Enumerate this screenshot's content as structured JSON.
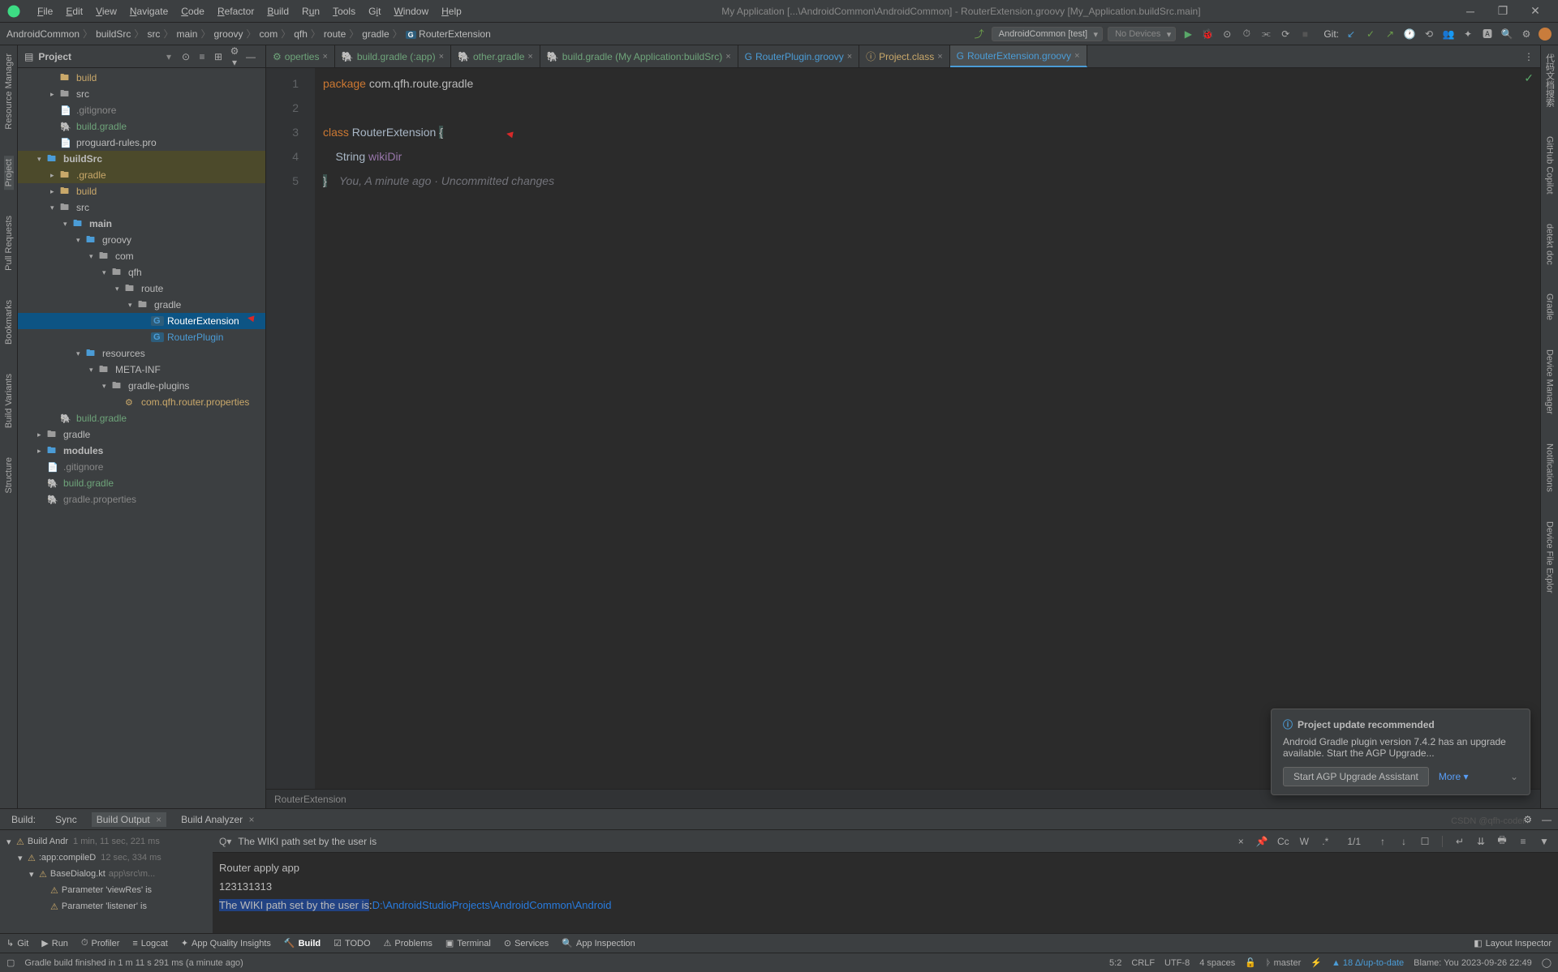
{
  "window": {
    "title": "My Application [...\\AndroidCommon\\AndroidCommon] - RouterExtension.groovy [My_Application.buildSrc.main]"
  },
  "menu": [
    "File",
    "Edit",
    "View",
    "Navigate",
    "Code",
    "Refactor",
    "Build",
    "Run",
    "Tools",
    "Git",
    "Window",
    "Help"
  ],
  "breadcrumb": [
    "AndroidCommon",
    "buildSrc",
    "src",
    "main",
    "groovy",
    "com",
    "qfh",
    "route",
    "gradle",
    "RouterExtension"
  ],
  "toolbar": {
    "runConfig": "AndroidCommon [test]",
    "device": "No Devices",
    "gitLabel": "Git:"
  },
  "projectPanel": {
    "title": "Project"
  },
  "tree": [
    {
      "depth": 2,
      "icon": "folder-open",
      "label": "build",
      "color": "#c9a86a"
    },
    {
      "depth": 2,
      "arrow": "▸",
      "icon": "folder",
      "label": "src"
    },
    {
      "depth": 2,
      "icon": "file",
      "label": ".gitignore",
      "fileColor": "#888"
    },
    {
      "depth": 2,
      "icon": "gradle",
      "label": "build.gradle",
      "color": "#6ea47a"
    },
    {
      "depth": 2,
      "icon": "file",
      "label": "proguard-rules.pro"
    },
    {
      "depth": 1,
      "arrow": "▾",
      "icon": "folder-b",
      "label": "buildSrc",
      "bold": true,
      "hl": true
    },
    {
      "depth": 2,
      "arrow": "▸",
      "icon": "folder-open",
      "label": ".gradle",
      "color": "#c9a86a",
      "hl": true
    },
    {
      "depth": 2,
      "arrow": "▸",
      "icon": "folder-open",
      "label": "build",
      "color": "#c9a86a"
    },
    {
      "depth": 2,
      "arrow": "▾",
      "icon": "folder",
      "label": "src"
    },
    {
      "depth": 3,
      "arrow": "▾",
      "icon": "folder-b",
      "label": "main",
      "bold": true
    },
    {
      "depth": 4,
      "arrow": "▾",
      "icon": "folder-b",
      "label": "groovy"
    },
    {
      "depth": 5,
      "arrow": "▾",
      "icon": "folder",
      "label": "com"
    },
    {
      "depth": 6,
      "arrow": "▾",
      "icon": "folder",
      "label": "qfh"
    },
    {
      "depth": 7,
      "arrow": "▾",
      "icon": "folder",
      "label": "route"
    },
    {
      "depth": 8,
      "arrow": "▾",
      "icon": "folder",
      "label": "gradle"
    },
    {
      "depth": 9,
      "icon": "groovy",
      "label": "RouterExtension",
      "sel": true
    },
    {
      "depth": 9,
      "icon": "groovy",
      "label": "RouterPlugin",
      "color": "#4b9cd6"
    },
    {
      "depth": 4,
      "arrow": "▾",
      "icon": "folder-b",
      "label": "resources"
    },
    {
      "depth": 5,
      "arrow": "▾",
      "icon": "folder",
      "label": "META-INF"
    },
    {
      "depth": 6,
      "arrow": "▾",
      "icon": "folder",
      "label": "gradle-plugins"
    },
    {
      "depth": 7,
      "icon": "props",
      "label": "com.qfh.router.properties",
      "color": "#c9a86a"
    },
    {
      "depth": 2,
      "icon": "gradle",
      "label": "build.gradle",
      "color": "#6ea47a"
    },
    {
      "depth": 1,
      "arrow": "▸",
      "icon": "folder",
      "label": "gradle"
    },
    {
      "depth": 1,
      "arrow": "▸",
      "icon": "folder-b",
      "label": "modules",
      "bold": true
    },
    {
      "depth": 1,
      "icon": "file",
      "label": ".gitignore",
      "fileColor": "#888"
    },
    {
      "depth": 1,
      "icon": "gradle",
      "label": "build.gradle",
      "color": "#6ea47a"
    },
    {
      "depth": 1,
      "icon": "gradle",
      "label": "gradle.properties",
      "color": "#888"
    }
  ],
  "tabs": [
    {
      "icon": "⚙",
      "label": "operties",
      "color": "#6ea47a"
    },
    {
      "icon": "🐘",
      "label": "build.gradle (:app)",
      "color": "#6ea47a"
    },
    {
      "icon": "🐘",
      "label": "other.gradle",
      "color": "#6ea47a"
    },
    {
      "icon": "🐘",
      "label": "build.gradle (My Application:buildSrc)",
      "color": "#6ea47a"
    },
    {
      "icon": "G",
      "label": "RouterPlugin.groovy",
      "color": "#4b9cd6"
    },
    {
      "icon": "ⓘ",
      "label": "Project.class",
      "color": "#c9a86a"
    },
    {
      "icon": "G",
      "label": "RouterExtension.groovy",
      "active": true,
      "color": "#4b9cd6"
    }
  ],
  "code": {
    "line1_kw": "package",
    "line1_rest": " com.qfh.route.gradle",
    "line3_kw": "class",
    "line3_cls": " RouterExtension ",
    "line3_brace": "{",
    "line4_type": "    String ",
    "line4_var": "wikiDir",
    "line5_brace": "}",
    "line5_comment": "    You, A minute ago · Uncommitted changes",
    "gutters": [
      "1",
      "2",
      "3",
      "4",
      "5"
    ]
  },
  "bottomBreadcrumb": "RouterExtension",
  "bottomTabs": {
    "build": "Build:",
    "sync": "Sync",
    "output": "Build Output",
    "analyzer": "Build Analyzer"
  },
  "buildTree": [
    {
      "depth": 0,
      "arrow": "▾",
      "warn": true,
      "label": "Build Andr",
      "time": "1 min, 11 sec, 221 ms"
    },
    {
      "depth": 1,
      "arrow": "▾",
      "warn": true,
      "label": ":app:compileD",
      "time": "12 sec, 334 ms"
    },
    {
      "depth": 2,
      "arrow": "▾",
      "warn": true,
      "label": "BaseDialog.kt",
      "path": "app\\src\\m..."
    },
    {
      "depth": 3,
      "warn": true,
      "label": "Parameter 'viewRes' is"
    },
    {
      "depth": 3,
      "warn": true,
      "label": "Parameter 'listener' is"
    }
  ],
  "consoleSearch": {
    "query": "The WIKI path set by the user is",
    "count": "1/1"
  },
  "consoleOutput": {
    "l1": "Router apply app",
    "l2": "123131313",
    "l3a": "The WIKI path set by the user is",
    "l3b": ":",
    "l3c": "D:\\AndroidStudioProjects\\AndroidCommon\\Android"
  },
  "bottomToolbar": [
    "Git",
    "Run",
    "Profiler",
    "Logcat",
    "App Quality Insights",
    "Build",
    "TODO",
    "Problems",
    "Terminal",
    "Services",
    "App Inspection"
  ],
  "bottomToolbarRight": "Layout Inspector",
  "statusbar": {
    "msg": "Gradle build finished in 1 m 11 s 291 ms (a minute ago)",
    "pos": "5:2",
    "crlf": "CRLF",
    "enc": "UTF-8",
    "indent": "4 spaces",
    "branch": "master",
    "warn": "18 ∆/up-to-date",
    "blame": "Blame: You 2023-09-26 22:49"
  },
  "leftPanel": [
    "Resource Manager",
    "Project",
    "Pull Requests",
    "Bookmarks",
    "Build Variants",
    "Structure"
  ],
  "rightPanel": [
    "代码文档搜索",
    "GitHub Copilot",
    "detekt doc",
    "Gradle",
    "Device Manager",
    "Notifications",
    "Device File Explor"
  ],
  "notification": {
    "title": "Project update recommended",
    "body": "Android Gradle plugin version 7.4.2 has an upgrade available. Start the AGP Upgrade...",
    "btn": "Start AGP Upgrade Assistant",
    "more": "More ▾"
  },
  "watermark": "CSDN @qfh-coder"
}
